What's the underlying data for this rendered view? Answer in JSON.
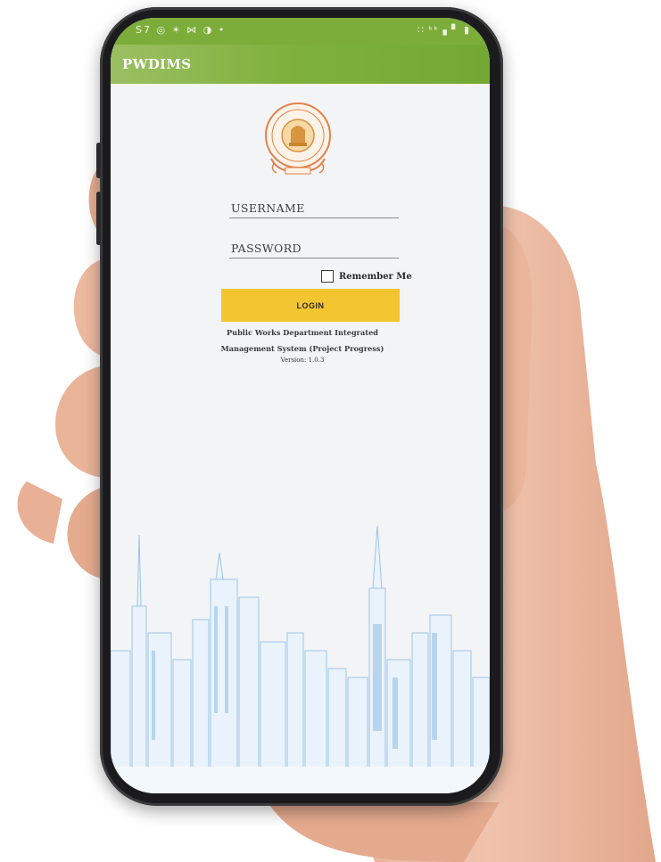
{
  "status_bar": {
    "left_icons": "S7 ◎ ✶ ⋈ ◑ •",
    "right_icons": "∷ ᵏᵏ ▖▘ ▮"
  },
  "app_bar": {
    "title": "PWDIMS"
  },
  "login_form": {
    "username_placeholder": "USERNAME",
    "password_placeholder": "PASSWORD",
    "remember_label": "Remember Me",
    "login_label": "LOGIN"
  },
  "info": {
    "line1": "Public Works Department Integrated",
    "line2": "Management System  (Project Progress)",
    "version": "Version: 1.0.3"
  },
  "colors": {
    "appbar": "#7cad3a",
    "login_button": "#f3c631",
    "screen_background": "#f3f4f6",
    "city_lines": "#9cc4e8"
  },
  "icons": [
    "state-emblem-logo",
    "checkbox-icon",
    "city-skyline-illustration"
  ]
}
